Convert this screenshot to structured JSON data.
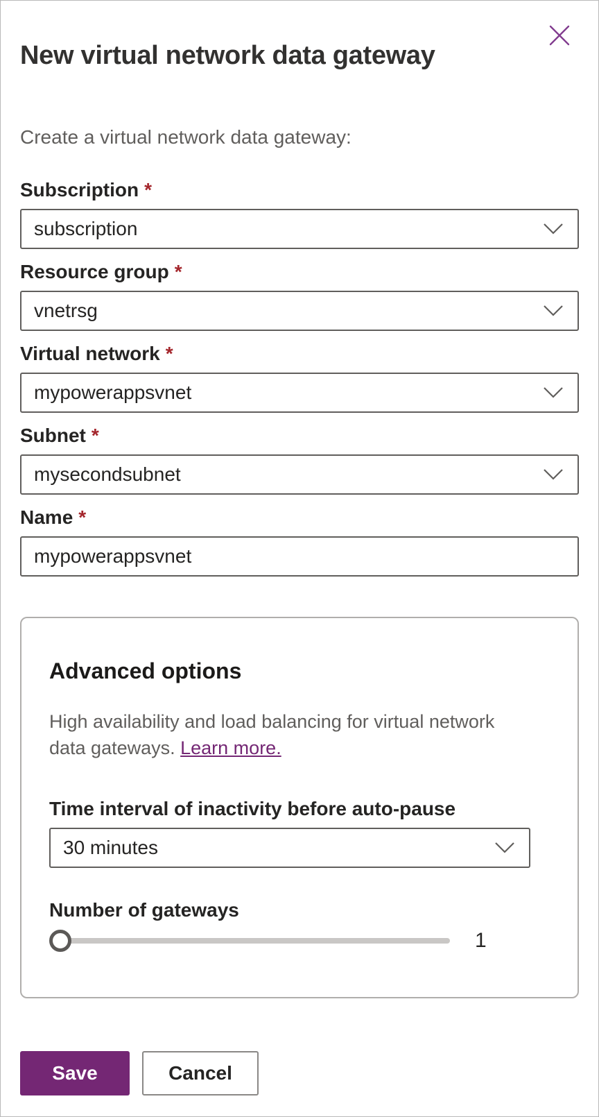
{
  "dialog": {
    "title": "New virtual network data gateway",
    "subtitle": "Create a virtual network data gateway:",
    "required_marker": "*"
  },
  "fields": [
    {
      "label": "Subscription",
      "required": true,
      "type": "dropdown",
      "value": "subscription"
    },
    {
      "label": "Resource group",
      "required": true,
      "type": "dropdown",
      "value": "vnetrsg"
    },
    {
      "label": "Virtual network",
      "required": true,
      "type": "dropdown",
      "value": "mypowerappsvnet"
    },
    {
      "label": "Subnet",
      "required": true,
      "type": "dropdown",
      "value": "mysecondsubnet"
    },
    {
      "label": "Name",
      "required": true,
      "type": "text",
      "value": "mypowerappsvnet"
    }
  ],
  "advanced": {
    "heading": "Advanced options",
    "description_line1": "High availability and load balancing for virtual network",
    "description_line2": "data gateways. ",
    "learn_more_label": "Learn more.",
    "auto_pause": {
      "label": "Time interval of inactivity before auto-pause",
      "value": "30 minutes"
    },
    "gateways": {
      "label": "Number of gateways",
      "value": "1"
    }
  },
  "actions": {
    "save_label": "Save",
    "cancel_label": "Cancel"
  },
  "icons": {
    "close": "close-x",
    "dropdown": "chevron-down"
  },
  "colors": {
    "accent": "#742774",
    "link": "#742774",
    "required": "#a4262c",
    "field_border": "#605e5c",
    "card_border": "#b0aeac",
    "muted_text": "#605e5c"
  }
}
